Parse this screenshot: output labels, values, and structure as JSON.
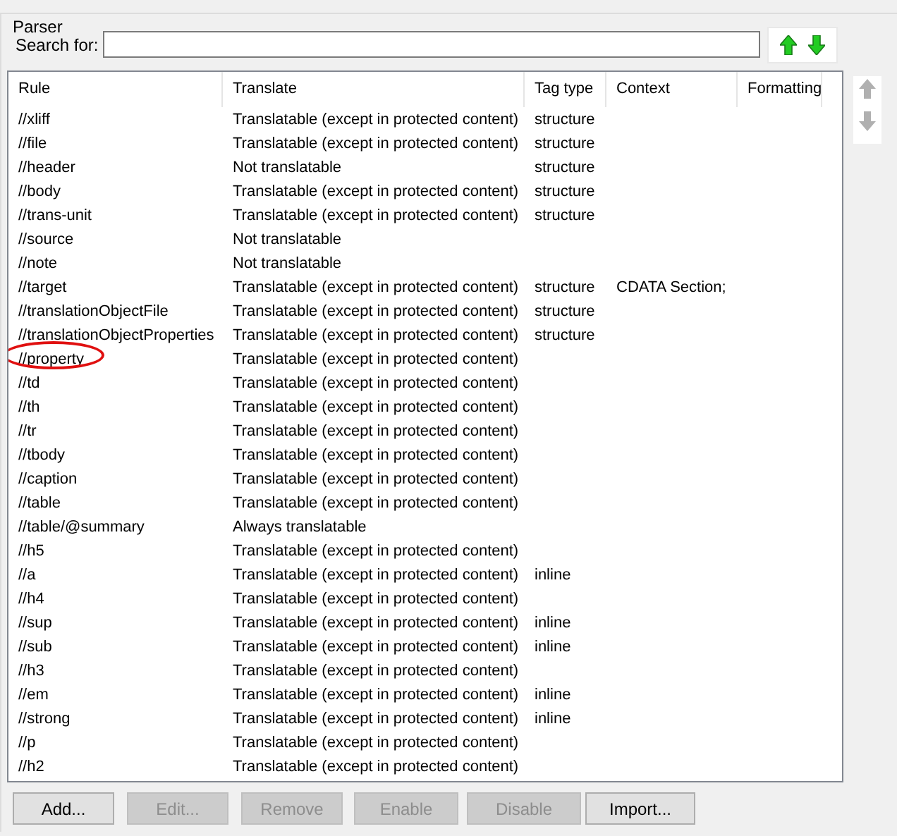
{
  "group": {
    "title": "Parser"
  },
  "search": {
    "label": "Search for:"
  },
  "table": {
    "columns": [
      "Rule",
      "Translate",
      "Tag type",
      "Context",
      "Formatting"
    ],
    "rows": [
      {
        "cells": [
          "//xliff",
          "Translatable (except in protected content)",
          "structure",
          ""
        ],
        "circled": false
      },
      {
        "cells": [
          "//file",
          "Translatable (except in protected content)",
          "structure",
          ""
        ],
        "circled": false
      },
      {
        "cells": [
          "//header",
          "Not translatable",
          "structure",
          ""
        ],
        "circled": false
      },
      {
        "cells": [
          "//body",
          "Translatable (except in protected content)",
          "structure",
          ""
        ],
        "circled": false
      },
      {
        "cells": [
          "//trans-unit",
          "Translatable (except in protected content)",
          "structure",
          ""
        ],
        "circled": false
      },
      {
        "cells": [
          "//source",
          "Not translatable",
          "",
          ""
        ],
        "circled": false
      },
      {
        "cells": [
          "//note",
          "Not translatable",
          "",
          ""
        ],
        "circled": false
      },
      {
        "cells": [
          "//target",
          "Translatable (except in protected content)",
          "structure",
          "CDATA Section;"
        ],
        "circled": false
      },
      {
        "cells": [
          "//translationObjectFile",
          "Translatable (except in protected content)",
          "structure",
          ""
        ],
        "circled": false
      },
      {
        "cells": [
          "//translationObjectProperties",
          "Translatable (except in protected content)",
          "structure",
          ""
        ],
        "circled": false
      },
      {
        "cells": [
          "//property",
          "Translatable (except in protected content)",
          "",
          ""
        ],
        "circled": true
      },
      {
        "cells": [
          "//td",
          "Translatable (except in protected content)",
          "",
          ""
        ],
        "circled": false
      },
      {
        "cells": [
          "//th",
          "Translatable (except in protected content)",
          "",
          ""
        ],
        "circled": false
      },
      {
        "cells": [
          "//tr",
          "Translatable (except in protected content)",
          "",
          ""
        ],
        "circled": false
      },
      {
        "cells": [
          "//tbody",
          "Translatable (except in protected content)",
          "",
          ""
        ],
        "circled": false
      },
      {
        "cells": [
          "//caption",
          "Translatable (except in protected content)",
          "",
          ""
        ],
        "circled": false
      },
      {
        "cells": [
          "//table",
          "Translatable (except in protected content)",
          "",
          ""
        ],
        "circled": false
      },
      {
        "cells": [
          "//table/@summary",
          "Always translatable",
          "",
          ""
        ],
        "circled": false
      },
      {
        "cells": [
          "//h5",
          "Translatable (except in protected content)",
          "",
          ""
        ],
        "circled": false
      },
      {
        "cells": [
          "//a",
          "Translatable (except in protected content)",
          "inline",
          ""
        ],
        "circled": false
      },
      {
        "cells": [
          "//h4",
          "Translatable (except in protected content)",
          "",
          ""
        ],
        "circled": false
      },
      {
        "cells": [
          "//sup",
          "Translatable (except in protected content)",
          "inline",
          ""
        ],
        "circled": false
      },
      {
        "cells": [
          "//sub",
          "Translatable (except in protected content)",
          "inline",
          ""
        ],
        "circled": false
      },
      {
        "cells": [
          "//h3",
          "Translatable (except in protected content)",
          "",
          ""
        ],
        "circled": false
      },
      {
        "cells": [
          "//em",
          "Translatable (except in protected content)",
          "inline",
          ""
        ],
        "circled": false
      },
      {
        "cells": [
          "//strong",
          "Translatable (except in protected content)",
          "inline",
          ""
        ],
        "circled": false
      },
      {
        "cells": [
          "//p",
          "Translatable (except in protected content)",
          "",
          ""
        ],
        "circled": false
      },
      {
        "cells": [
          "//h2",
          "Translatable (except in protected content)",
          "",
          ""
        ],
        "circled": false
      }
    ]
  },
  "buttons": [
    {
      "label": "Add...",
      "disabled": false
    },
    {
      "label": "Edit...",
      "disabled": true
    },
    {
      "label": "Remove",
      "disabled": true
    },
    {
      "label": "Enable",
      "disabled": true
    },
    {
      "label": "Disable",
      "disabled": true
    },
    {
      "label": "Import...",
      "disabled": false
    }
  ]
}
